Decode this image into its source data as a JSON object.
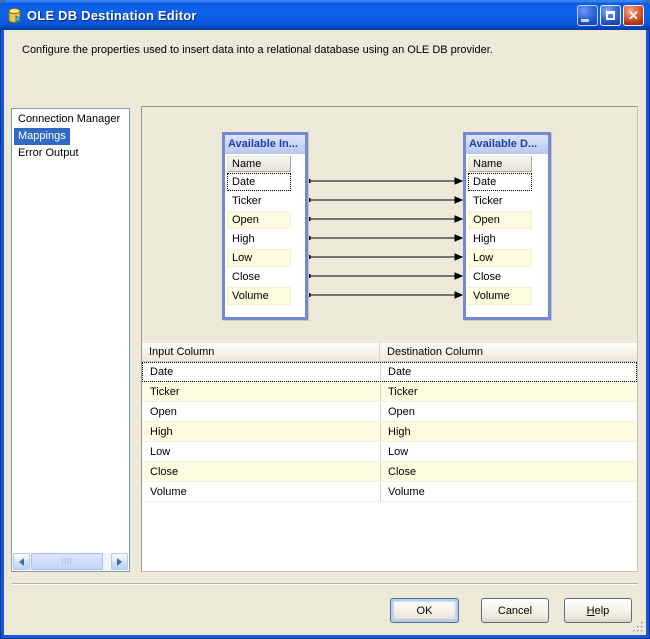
{
  "window": {
    "title": "OLE DB Destination Editor"
  },
  "description": "Configure the properties used to insert data into a relational database using an OLE DB provider.",
  "sidebar": {
    "items": [
      {
        "label": "Connection Manager",
        "selected": false
      },
      {
        "label": "Mappings",
        "selected": true
      },
      {
        "label": "Error Output",
        "selected": false
      }
    ]
  },
  "diagram": {
    "source_box": {
      "title": "Available In...",
      "column_header": "Name",
      "rows": [
        "Date",
        "Ticker",
        "Open",
        "High",
        "Low",
        "Close",
        "Volume"
      ],
      "focused_row": "Date"
    },
    "destination_box": {
      "title": "Available D...",
      "column_header": "Name",
      "rows": [
        "Date",
        "Ticker",
        "Open",
        "High",
        "Low",
        "Close",
        "Volume"
      ],
      "focused_row": "Date"
    },
    "connections": [
      [
        "Date",
        "Date"
      ],
      [
        "Ticker",
        "Ticker"
      ],
      [
        "Open",
        "Open"
      ],
      [
        "High",
        "High"
      ],
      [
        "Low",
        "Low"
      ],
      [
        "Close",
        "Close"
      ],
      [
        "Volume",
        "Volume"
      ]
    ]
  },
  "mapping_grid": {
    "columns": [
      "Input Column",
      "Destination Column"
    ],
    "rows": [
      {
        "input": "Date",
        "destination": "Date"
      },
      {
        "input": "Ticker",
        "destination": "Ticker"
      },
      {
        "input": "Open",
        "destination": "Open"
      },
      {
        "input": "High",
        "destination": "High"
      },
      {
        "input": "Low",
        "destination": "Low"
      },
      {
        "input": "Close",
        "destination": "Close"
      },
      {
        "input": "Volume",
        "destination": "Volume"
      }
    ]
  },
  "footer": {
    "ok_label": "OK",
    "cancel_label": "Cancel",
    "help_label": "Help"
  },
  "colors": {
    "titlebar_blue": "#0b5be4",
    "selection_blue": "#316ac5",
    "row_alt_yellow": "#fdfce1",
    "mapbox_border": "#7589d3",
    "dialog_face": "#ece9d8"
  }
}
